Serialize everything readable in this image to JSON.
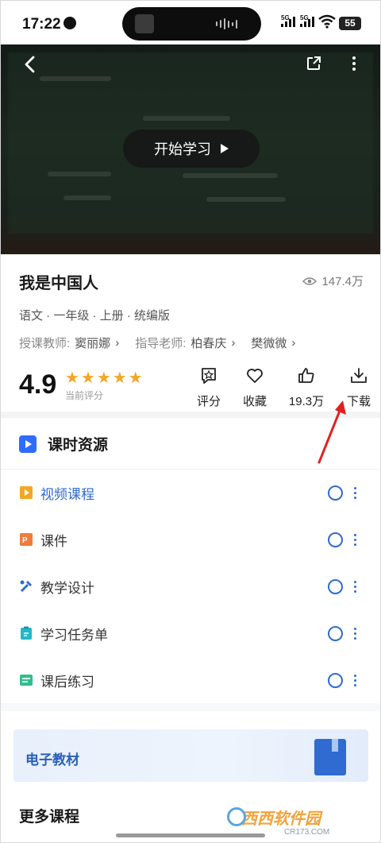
{
  "status_bar": {
    "time": "17:22",
    "battery": "55",
    "signal_labels": [
      "5G",
      "5G"
    ]
  },
  "video": {
    "start_label": "开始学习"
  },
  "course": {
    "title": "我是中国人",
    "views": "147.4万",
    "meta": "语文 · 一年级 · 上册 · 统编版",
    "teacher_label": "授课教师:",
    "teacher": "窦丽娜",
    "advisor_label": "指导老师:",
    "advisors": [
      "柏春庆",
      "樊微微"
    ]
  },
  "rating": {
    "score": "4.9",
    "stars": 5,
    "label": "当前评分"
  },
  "actions": [
    {
      "label": "评分",
      "icon": "star-rate-icon"
    },
    {
      "label": "收藏",
      "icon": "heart-icon"
    },
    {
      "label": "19.3万",
      "icon": "thumbs-up-icon"
    },
    {
      "label": "下载",
      "icon": "download-icon"
    }
  ],
  "resources": {
    "title": "课时资源",
    "items": [
      {
        "label": "视频课程",
        "icon": "video-icon",
        "color": "#f5a623"
      },
      {
        "label": "课件",
        "icon": "ppt-icon",
        "color": "#f07c3a"
      },
      {
        "label": "教学设计",
        "icon": "design-icon",
        "color": "#2f6bd0"
      },
      {
        "label": "学习任务单",
        "icon": "task-icon",
        "color": "#22b8c8"
      },
      {
        "label": "课后练习",
        "icon": "exercise-icon",
        "color": "#2fc08a"
      }
    ]
  },
  "etextbook": {
    "label": "电子教材"
  },
  "more_courses": {
    "title": "更多课程"
  },
  "watermark": {
    "brand": "西西软件园",
    "url": "CR173.COM"
  },
  "colors": {
    "accent": "#2f6bd0",
    "star": "#f5a623",
    "annotation_arrow": "#e02020"
  }
}
